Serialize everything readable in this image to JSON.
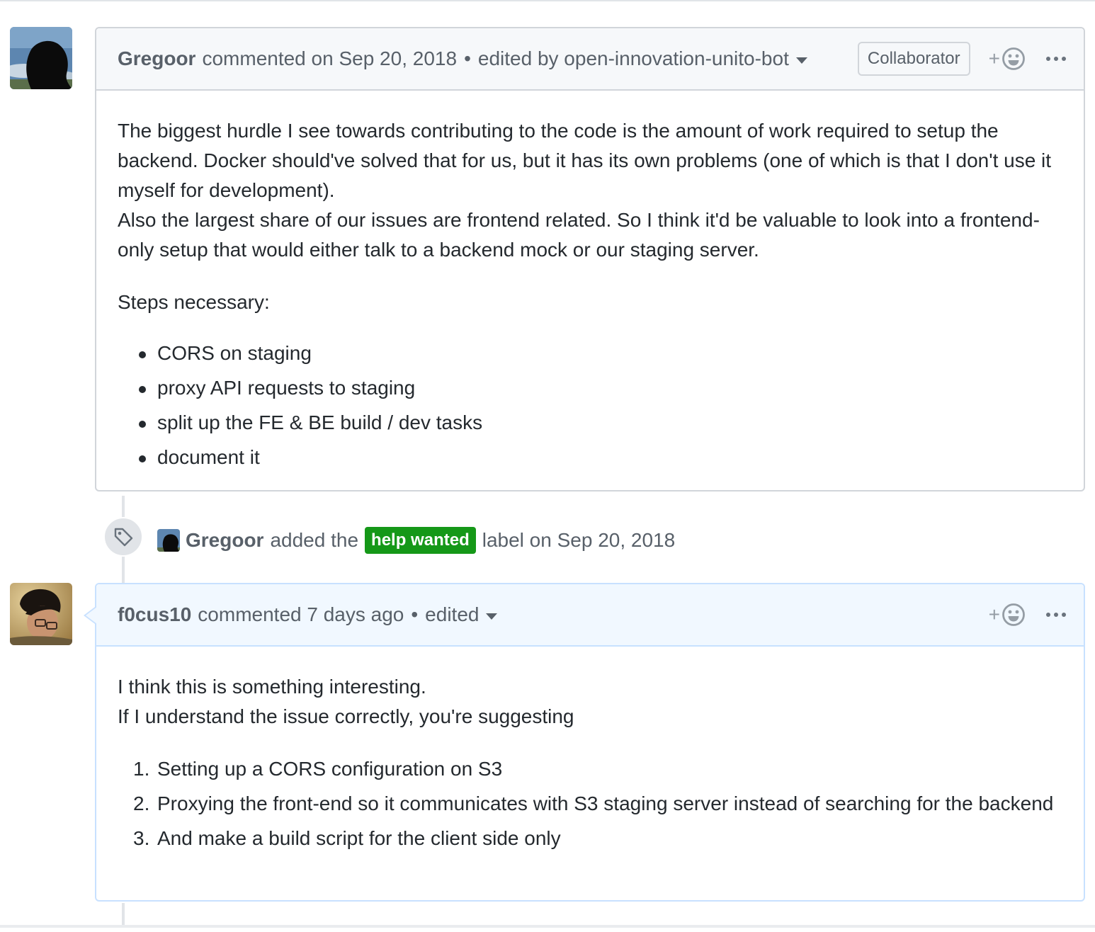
{
  "comments": [
    {
      "author": "Gregoor",
      "meta": "commented on Sep 20, 2018",
      "separator": "•",
      "edited": "edited by open-innovation-unito-bot",
      "badge": "Collaborator",
      "react_plus": "+",
      "paragraphs": [
        "The biggest hurdle I see towards contributing to the code is the amount of work required to setup the backend. Docker should've solved that for us, but it has its own problems (one of which is that I don't use it myself for development).",
        "Also the largest share of our issues are frontend related. So I think it'd be valuable to look into a frontend-only setup that would either talk to a backend mock or our staging server.",
        "Steps necessary:"
      ],
      "bullets": [
        "CORS on staging",
        "proxy API requests to staging",
        "split up the FE & BE build / dev tasks",
        "document it"
      ]
    },
    {
      "author": "f0cus10",
      "meta": "commented 7 days ago",
      "separator": "•",
      "edited": "edited",
      "react_plus": "+",
      "paragraphs": [
        "I think this is something interesting.",
        "If I understand the issue correctly, you're suggesting"
      ],
      "steps": [
        {
          "num": "1.",
          "text": "Setting up a CORS configuration on S3"
        },
        {
          "num": "2.",
          "text": "Proxying the front-end so it communicates with S3 staging server instead of searching for the backend"
        },
        {
          "num": "3.",
          "text": "And make a build script for the client side only"
        }
      ]
    }
  ],
  "event": {
    "actor": "Gregoor",
    "action": "added the",
    "label": "help wanted",
    "suffix": "label on Sep 20, 2018",
    "label_color": "#159818"
  },
  "icons": {
    "event": "tag-icon",
    "reaction": "smiley-icon",
    "menu": "kebab-horizontal-icon"
  }
}
